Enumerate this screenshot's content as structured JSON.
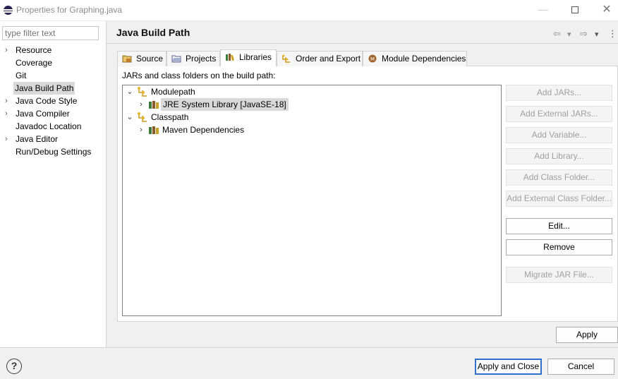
{
  "window": {
    "title": "Properties for Graphing.java",
    "minimize_glyph": "—",
    "close_glyph": "✕"
  },
  "sidebar": {
    "filter_placeholder": "type filter text",
    "items": [
      {
        "label": "Resource",
        "expandable": true
      },
      {
        "label": "Coverage",
        "expandable": false
      },
      {
        "label": "Git",
        "expandable": false
      },
      {
        "label": "Java Build Path",
        "expandable": false,
        "selected": true
      },
      {
        "label": "Java Code Style",
        "expandable": true
      },
      {
        "label": "Java Compiler",
        "expandable": true
      },
      {
        "label": "Javadoc Location",
        "expandable": false
      },
      {
        "label": "Java Editor",
        "expandable": true
      },
      {
        "label": "Run/Debug Settings",
        "expandable": false
      }
    ]
  },
  "header": {
    "title": "Java Build Path",
    "back_glyph": "⇦",
    "forward_glyph": "⇨",
    "dropdown_glyph": "▾",
    "menu_glyph": "⋮"
  },
  "tabs": [
    {
      "label": "Source",
      "icon": "source-folder-icon"
    },
    {
      "label": "Projects",
      "icon": "projects-icon"
    },
    {
      "label": "Libraries",
      "icon": "libraries-icon",
      "active": true
    },
    {
      "label": "Order and Export",
      "icon": "order-export-icon"
    },
    {
      "label": "Module Dependencies",
      "icon": "module-icon"
    }
  ],
  "libraries": {
    "caption": "JARs and class folders on the build path:",
    "tree": [
      {
        "label": "Modulepath",
        "expanded": true,
        "level": 0,
        "icon": "path-container-icon"
      },
      {
        "label": "JRE System Library [JavaSE-18]",
        "expanded": false,
        "level": 1,
        "icon": "library-icon",
        "selected": true
      },
      {
        "label": "Classpath",
        "expanded": true,
        "level": 0,
        "icon": "path-container-icon"
      },
      {
        "label": "Maven Dependencies",
        "expanded": false,
        "level": 1,
        "icon": "library-icon"
      }
    ],
    "buttons": [
      {
        "label": "Add JARs...",
        "enabled": false
      },
      {
        "label": "Add External JARs...",
        "enabled": false
      },
      {
        "label": "Add Variable...",
        "enabled": false
      },
      {
        "label": "Add Library...",
        "enabled": false
      },
      {
        "label": "Add Class Folder...",
        "enabled": false
      },
      {
        "label": "Add External Class Folder...",
        "enabled": false
      },
      {
        "label": "Edit...",
        "enabled": true
      },
      {
        "label": "Remove",
        "enabled": true
      },
      {
        "label": "Migrate JAR File...",
        "enabled": false
      }
    ]
  },
  "footer": {
    "apply": "Apply",
    "help_glyph": "?",
    "apply_and_close": "Apply and Close",
    "cancel": "Cancel"
  }
}
